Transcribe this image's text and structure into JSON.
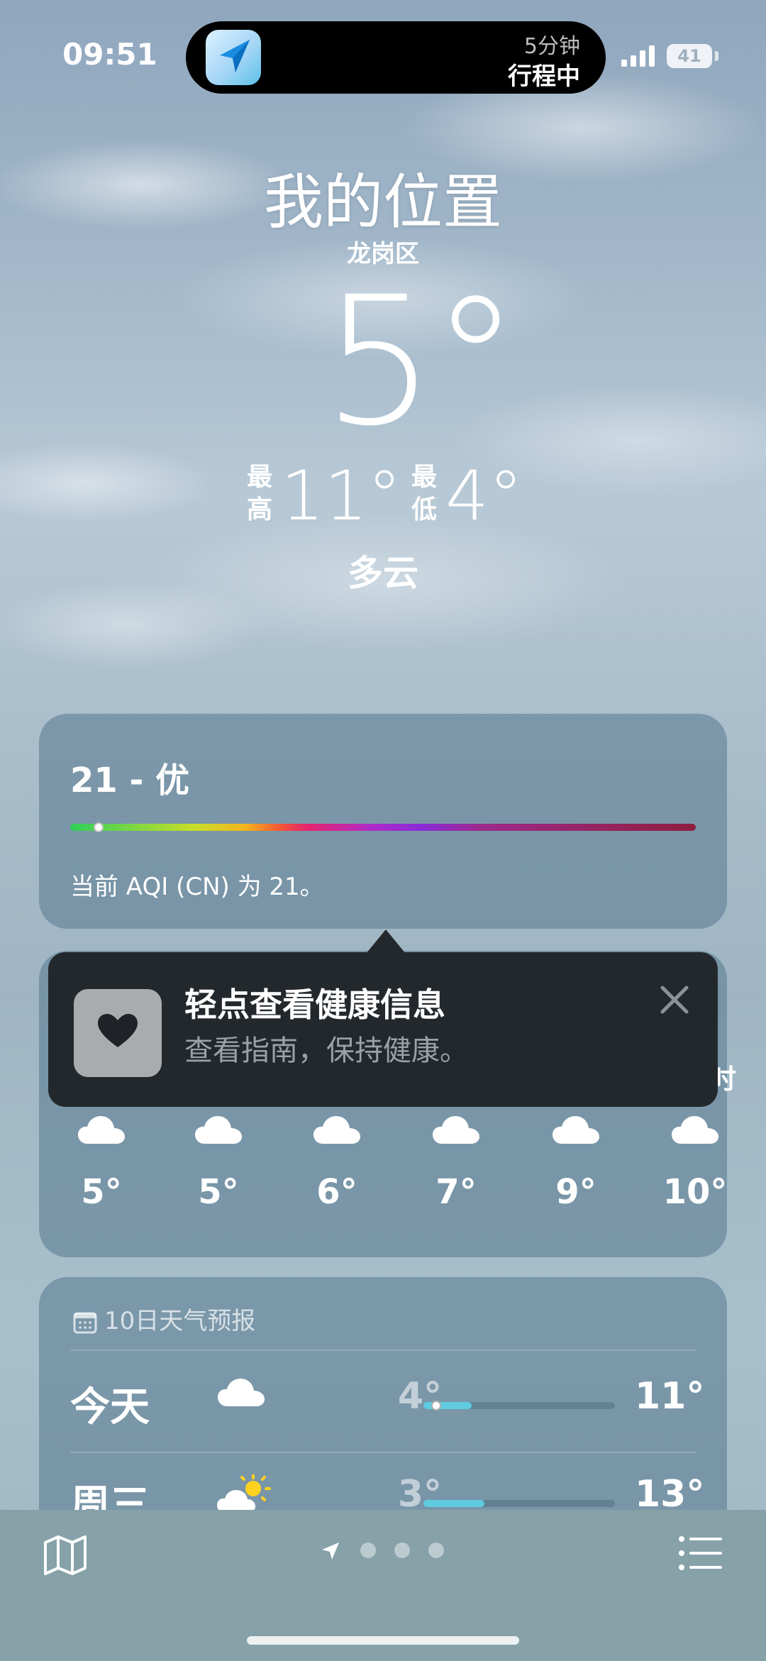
{
  "status_bar": {
    "time": "09:51",
    "eta": "5分钟",
    "trip_status": "行程中",
    "battery": "41"
  },
  "header": {
    "location_title": "我的位置",
    "district": "龙岗区",
    "current_temp": "5°",
    "high_label": "最高",
    "high_temp": "11°",
    "low_label": "最低",
    "low_temp": "4°",
    "condition": "多云"
  },
  "aqi": {
    "value_text": "21 - 优",
    "description": "当前 AQI (CN) 为 21。",
    "indicator_fraction": 0.045
  },
  "tooltip": {
    "title": "轻点查看健康信息",
    "subtitle": "查看指南，保持健康。",
    "icon": "heart-icon"
  },
  "hourly": {
    "edge_char": "时",
    "items": [
      {
        "icon": "cloud-icon",
        "temp": "5°"
      },
      {
        "icon": "cloud-icon",
        "temp": "5°"
      },
      {
        "icon": "cloud-icon",
        "temp": "6°"
      },
      {
        "icon": "cloud-icon",
        "temp": "7°"
      },
      {
        "icon": "cloud-icon",
        "temp": "9°"
      },
      {
        "icon": "cloud-icon",
        "temp": "10°"
      }
    ]
  },
  "ten_day": {
    "header": "10日天气预报",
    "days": [
      {
        "name": "今天",
        "icon": "cloud-icon",
        "low": "4°",
        "high": "11°",
        "range_start": 0.0,
        "range_end": 0.25,
        "current_fraction": 0.04
      },
      {
        "name": "周三",
        "icon": "sun-cloud-icon",
        "low": "3°",
        "high": "13°",
        "range_start": 0.0,
        "range_end": 0.32
      }
    ]
  },
  "colors": {
    "card_bg": "#5f8094",
    "tooltip_bg": "#23282d",
    "range_fill": "#5fcbe0",
    "bottom_bar": "#86a1a8"
  }
}
